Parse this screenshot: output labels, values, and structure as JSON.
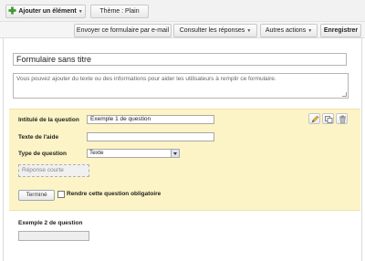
{
  "toolbar": {
    "add_element_label": "Ajouter un élément",
    "theme_label": "Thème : Plain"
  },
  "actions": {
    "send_label": "Envoyer ce formulaire par e-mail",
    "responses_label": "Consulter les réponses",
    "more_label": "Autres actions",
    "save_label": "Enregistrer"
  },
  "form": {
    "title": "Formulaire sans titre",
    "description": "Vous pouvez ajouter du texte ou des informations pour aider les utilisateurs à remplir ce formulaire."
  },
  "question_editor": {
    "title_label": "Intitulé de la question",
    "title_value": "Exemple 1 de question",
    "help_label": "Texte de l'aide",
    "help_value": "",
    "type_label": "Type de question",
    "type_value": "Texte",
    "preview_label": "Réponse courte",
    "done_label": "Terminé",
    "required_label": "Rendre cette question obligatoire",
    "required_checked": false
  },
  "question2": {
    "title": "Exemple 2 de question"
  },
  "colors": {
    "editor_background": "#fcf4c6",
    "toolbar_background": "#f2f2f2",
    "add_icon": "#3a9a2e"
  },
  "icons": {
    "edit": "pencil-icon",
    "duplicate": "duplicate-icon",
    "delete": "trash-icon",
    "add": "plus-icon"
  }
}
